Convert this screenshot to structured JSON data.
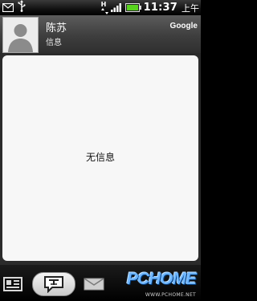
{
  "status_bar": {
    "icons": [
      "mail-icon",
      "usb-icon",
      "network-h-icon",
      "signal-icon",
      "battery-icon"
    ],
    "network_label": "H",
    "time": "11:37",
    "ampm": "上午"
  },
  "header": {
    "contact_name": "陈苏",
    "subtitle": "信息",
    "provider": "Google"
  },
  "content": {
    "empty_message": "无信息"
  },
  "tabs": [
    {
      "name": "contact-card",
      "icon": "contact-card-icon",
      "selected": false
    },
    {
      "name": "messages",
      "icon": "message-bubble-icon",
      "selected": true
    },
    {
      "name": "email",
      "icon": "envelope-icon",
      "selected": false
    }
  ],
  "watermark": {
    "brand": "PCHOME",
    "url": "WWW.PCHOME.NET"
  },
  "colors": {
    "accent_battery": "#58d21e",
    "watermark_blue": "#6fb6ff"
  }
}
